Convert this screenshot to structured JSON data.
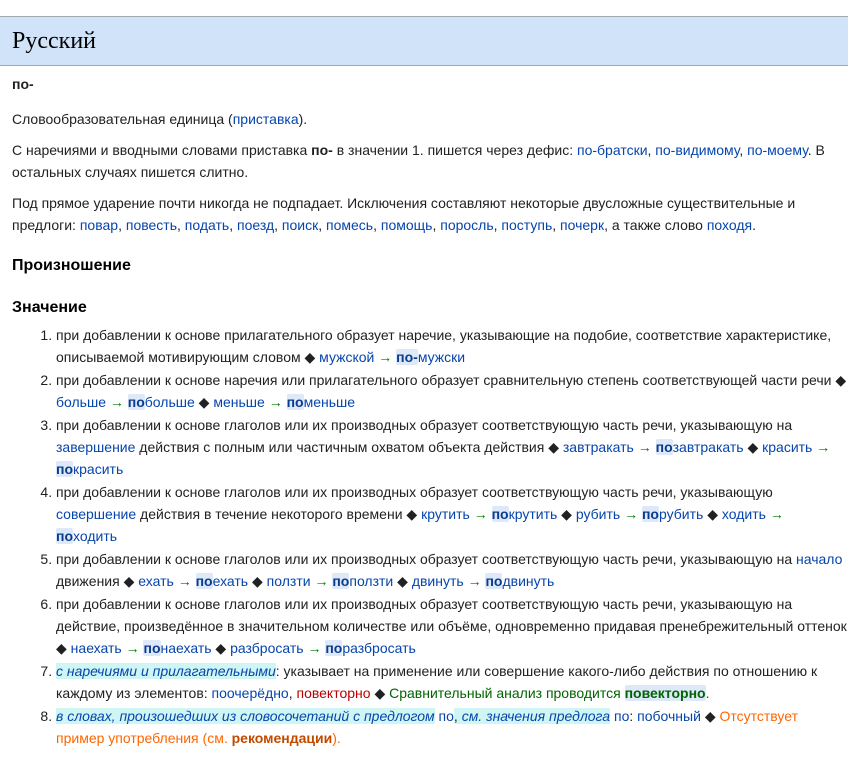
{
  "language_header": "Русский",
  "word": "по-",
  "intro": {
    "p1": {
      "before": "Словообразовательная единица (",
      "link": "приставка",
      "after": ")."
    },
    "p2": {
      "before": "С наречиями и вводными словами приставка ",
      "bold": "по-",
      "middle": " в значении 1. пишется через дефис: ",
      "links": [
        "по-братски",
        "по-видимому",
        "по-моему"
      ],
      "after": ". В остальных случаях пишется слитно."
    },
    "p3": {
      "before": "Под прямое ударение почти никогда не подпадает. Исключения составляют некоторые двусложные существительные и предлоги: ",
      "links": [
        "повар",
        "повесть",
        "подать",
        "поезд",
        "поиск",
        "помесь",
        "помощь",
        "поросль",
        "поступь",
        "почерк"
      ],
      "middle": ", а также слово ",
      "last_link": "походя",
      "after": "."
    }
  },
  "headings": {
    "pronunciation": "Произношение",
    "meaning": "Значение"
  },
  "meanings": {
    "m1": {
      "text": "при добавлении к основе прилагательного образует наречие, указывающие на подобие, соответствие характеристике, описываемой мотивирующим словом",
      "ex1_base": "мужской",
      "ex1_prefix": "по-",
      "ex1_rest": "мужски"
    },
    "m2": {
      "text": "при добавлении к основе наречия или прилагательного образует сравнительную степень соответствующей части речи",
      "ex1_base": "больше",
      "ex1_prefix": "по",
      "ex1_rest": "больше",
      "ex2_base": "меньше",
      "ex2_prefix": "по",
      "ex2_rest": "меньше"
    },
    "m3": {
      "text_before": "при добавлении к основе глаголов или их производных образует соответствующую часть речи, указывающую на ",
      "link": "завершение",
      "text_after": " действия с полным или частичным охватом объекта действия",
      "ex1_base": "завтракать",
      "ex1_prefix": "по",
      "ex1_rest": "завтракать",
      "ex2_base": "красить",
      "ex2_prefix": "по",
      "ex2_rest": "красить"
    },
    "m4": {
      "text_before": "при добавлении к основе глаголов или их производных образует соответствующую часть речи, указывающую ",
      "link": "совершение",
      "text_after": " действия в течение некоторого времени",
      "ex1_base": "крутить",
      "ex1_prefix": "по",
      "ex1_rest": "крутить",
      "ex2_base": "рубить",
      "ex2_prefix": "по",
      "ex2_rest": "рубить",
      "ex3_base": "ходить",
      "ex3_prefix": "по",
      "ex3_rest": "ходить"
    },
    "m5": {
      "text_before": "при добавлении к основе глаголов или их производных образует соответствующую часть речи, указывающую на ",
      "link": "начало",
      "text_after": " движения",
      "ex1_base": "ехать",
      "ex1_prefix": "по",
      "ex1_rest": "ехать",
      "ex2_base": "ползти",
      "ex2_prefix": "по",
      "ex2_rest": "ползти",
      "ex3_base": "двинуть",
      "ex3_prefix": "по",
      "ex3_rest": "двинуть"
    },
    "m6": {
      "text": "при добавлении к основе глаголов или их производных образует соответствующую часть речи, указывающую на действие, произведённое в значительном количестве или объёме, одновременно придавая пренебрежительный оттенок",
      "ex1_base": "наехать",
      "ex1_prefix": "по",
      "ex1_rest": "наехать",
      "ex2_base": "разбросать",
      "ex2_prefix": "по",
      "ex2_rest": "разбросать"
    },
    "m7": {
      "note": "с наречиями и прилагательными",
      "text": ": указывает на применение или совершение какого-либо действия по отношению к каждому из элементов: ",
      "link1": "поочерёдно",
      "sep": ", ",
      "link2": "повекторно",
      "example": "Сравнительный анализ проводится ",
      "example_bold": "повекторно",
      "example_end": "."
    },
    "m8": {
      "note1": "в словах, произошедших из словосочетаний с предлогом",
      "link1": "по",
      "note2": "см. значения предлога",
      "link2": "по",
      "colon": ":",
      "link3": "побочный",
      "missing": "Отсутствует пример употребления (см. ",
      "missing_bold": "рекомендации",
      "missing_end": ")."
    }
  },
  "symbols": {
    "arrow": "→",
    "bullet": "◆"
  },
  "colors": {
    "header_bg": "#d1e3f8",
    "link": "#0645ad",
    "redlink": "#ba0000",
    "note_bg": "#cff6f4",
    "mark_bg": "#dde8f8",
    "warning": "#ff6600",
    "example_green": "#006400"
  }
}
